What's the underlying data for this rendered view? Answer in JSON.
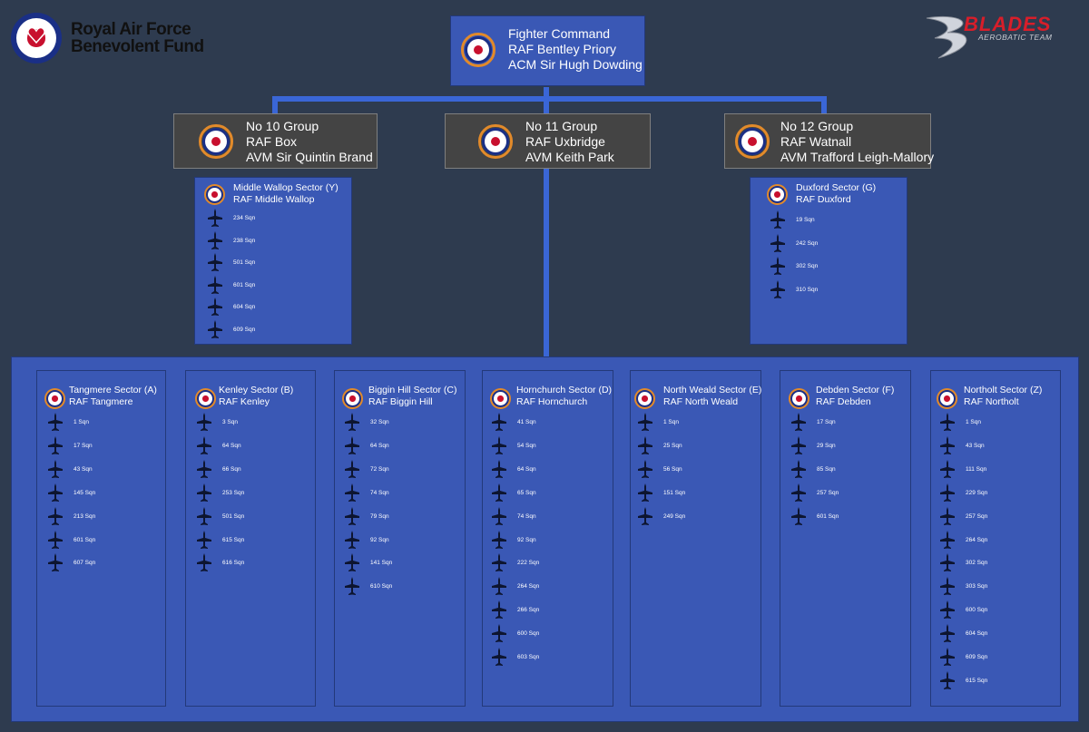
{
  "logos": {
    "left_line1": "Royal Air Force",
    "left_line2": "Benevolent Fund",
    "right_main": "BLADES",
    "right_sub": "AEROBATIC TEAM"
  },
  "command": {
    "line1": "Fighter Command",
    "line2": "RAF Bentley Priory",
    "line3": "ACM Sir Hugh Dowding"
  },
  "groups": [
    {
      "line1": "No 10 Group",
      "line2": "RAF Box",
      "line3": "AVM Sir Quintin Brand"
    },
    {
      "line1": "No 11 Group",
      "line2": "RAF Uxbridge",
      "line3": "AVM Keith Park"
    },
    {
      "line1": "No 12 Group",
      "line2": "RAF Watnall",
      "line3": "AVM Trafford Leigh-Mallory"
    }
  ],
  "group10_sector": {
    "name": "Middle Wallop Sector (Y)",
    "station": "RAF Middle Wallop",
    "squadrons": [
      "234 Sqn",
      "238 Sqn",
      "501 Sqn",
      "601 Sqn",
      "604 Sqn",
      "609 Sqn"
    ]
  },
  "group12_sector": {
    "name": "Duxford Sector (G)",
    "station": "RAF Duxford",
    "squadrons": [
      "19 Sqn",
      "242 Sqn",
      "302 Sqn",
      "310 Sqn"
    ]
  },
  "group11_sectors": [
    {
      "name": "Tangmere Sector (A)",
      "station": "RAF Tangmere",
      "squadrons": [
        "1 Sqn",
        "17 Sqn",
        "43 Sqn",
        "145 Sqn",
        "213 Sqn",
        "601 Sqn",
        "607 Sqn"
      ]
    },
    {
      "name": "Kenley Sector (B)",
      "station": "RAF Kenley",
      "squadrons": [
        "3 Sqn",
        "64 Sqn",
        "66 Sqn",
        "253 Sqn",
        "501 Sqn",
        "615 Sqn",
        "616 Sqn"
      ]
    },
    {
      "name": "Biggin Hill Sector (C)",
      "station": "RAF Biggin Hill",
      "squadrons": [
        "32 Sqn",
        "64 Sqn",
        "72 Sqn",
        "74 Sqn",
        "79 Sqn",
        "92 Sqn",
        "141 Sqn",
        "610 Sqn"
      ]
    },
    {
      "name": "Hornchurch Sector (D)",
      "station": "RAF Hornchurch",
      "squadrons": [
        "41 Sqn",
        "54 Sqn",
        "64 Sqn",
        "65 Sqn",
        "74 Sqn",
        "92 Sqn",
        "222 Sqn",
        "264 Sqn",
        "266 Sqn",
        "600 Sqn",
        "603 Sqn"
      ]
    },
    {
      "name": "North Weald Sector (E)",
      "station": "RAF North Weald",
      "squadrons": [
        "1 Sqn",
        "25 Sqn",
        "56 Sqn",
        "151 Sqn",
        "249 Sqn"
      ]
    },
    {
      "name": "Debden Sector (F)",
      "station": "RAF Debden",
      "squadrons": [
        "17 Sqn",
        "29 Sqn",
        "85 Sqn",
        "257 Sqn",
        "601 Sqn"
      ]
    },
    {
      "name": "Northolt Sector (Z)",
      "station": "RAF Northolt",
      "squadrons": [
        "1 Sqn",
        "43 Sqn",
        "111 Sqn",
        "229 Sqn",
        "257 Sqn",
        "264 Sqn",
        "302 Sqn",
        "303 Sqn",
        "600 Sqn",
        "604 Sqn",
        "609 Sqn",
        "615 Sqn"
      ]
    }
  ],
  "colors": {
    "background": "#2e3b4f",
    "box_blue": "#3a58b5",
    "box_grey": "#444444",
    "connector": "#3a66d6",
    "roundel_ring": "#e28a2a"
  }
}
